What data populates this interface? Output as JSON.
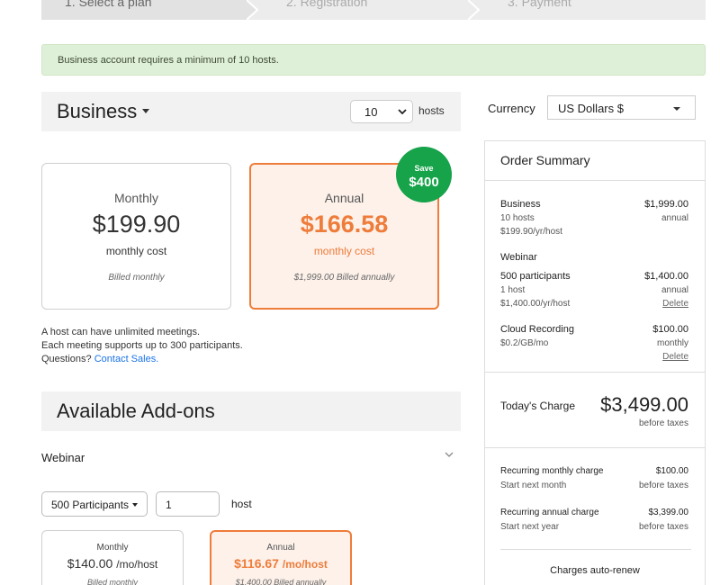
{
  "steps": [
    "1. Select a plan",
    "2. Registration",
    "3. Payment"
  ],
  "alert": "Business account requires a minimum of 10 hosts.",
  "plan": {
    "name": "Business",
    "hosts_value": "10",
    "hosts_label": "hosts"
  },
  "currency": {
    "label": "Currency",
    "value": "US Dollars $"
  },
  "cards": {
    "monthly": {
      "period": "Monthly",
      "price": "$199.90",
      "cost": "monthly cost",
      "billed": "Billed monthly"
    },
    "annual": {
      "period": "Annual",
      "price": "$166.58",
      "cost": "monthly cost",
      "billed": "$1,999.00 Billed annually"
    },
    "save_small": "Save",
    "save_big": "$400"
  },
  "info": {
    "line1": "A host can have unlimited meetings.",
    "line2": "Each meeting supports up to 300 participants.",
    "line3_prefix": "Questions?",
    "contact_link": "Contact Sales."
  },
  "addons": {
    "title": "Available Add-ons",
    "webinar_label": "Webinar",
    "participants": "500 Participants",
    "host_count": "1",
    "host_suffix": "host",
    "monthly": {
      "period": "Monthly",
      "price": "$140.00",
      "unit": "/mo/host",
      "billed": "Billed monthly"
    },
    "annual": {
      "period": "Annual",
      "price": "$116.67",
      "unit": "/mo/host",
      "billed": "$1,400.00 Billed annually"
    }
  },
  "summary": {
    "title": "Order Summary",
    "business": {
      "name": "Business",
      "amount": "$1,999.00",
      "sub1": "10 hosts",
      "sub2": "$199.90/yr/host",
      "freq": "annual"
    },
    "webinar": {
      "heading": "Webinar",
      "name": "500 participants",
      "amount": "$1,400.00",
      "sub1": "1 host",
      "sub2": "$1,400.00/yr/host",
      "freq": "annual",
      "delete": "Delete"
    },
    "recording": {
      "name": "Cloud Recording",
      "amount": "$100.00",
      "sub1": "$0.2/GB/mo",
      "freq": "monthly",
      "delete": "Delete"
    },
    "today_label": "Today's Charge",
    "today_amount": "$3,499.00",
    "today_sub": "before taxes",
    "recurring_monthly": {
      "label": "Recurring monthly charge",
      "amount": "$100.00",
      "sub": "Start next month",
      "sub_right": "before taxes"
    },
    "recurring_annual": {
      "label": "Recurring annual charge",
      "amount": "$3,399.00",
      "sub": "Start next year",
      "sub_right": "before taxes"
    },
    "autorenew": "Charges auto-renew"
  }
}
